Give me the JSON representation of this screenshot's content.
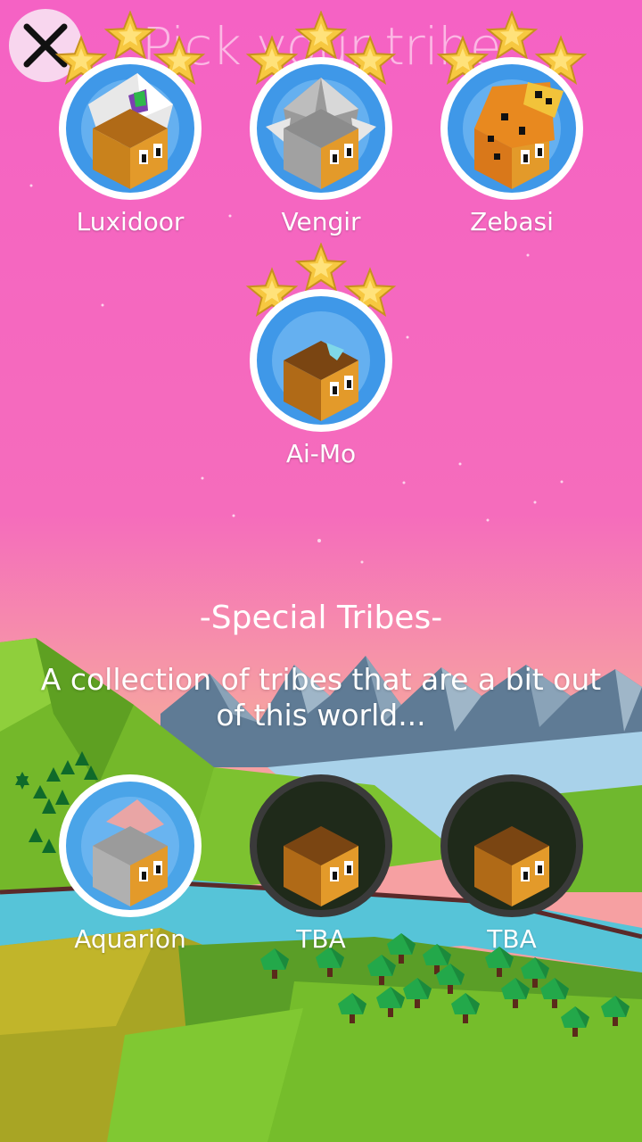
{
  "header": {
    "title": "Pick your tribe"
  },
  "close_button": {
    "icon": "close-icon"
  },
  "tribes": [
    {
      "name": "Luxidoor",
      "stars": 3,
      "unlocked": true
    },
    {
      "name": "Vengir",
      "stars": 3,
      "unlocked": true
    },
    {
      "name": "Zebasi",
      "stars": 3,
      "unlocked": true
    },
    {
      "name": "Ai-Mo",
      "stars": 3,
      "unlocked": true
    }
  ],
  "special": {
    "title": "-Special Tribes-",
    "description": "A collection of tribes that are a bit out of this world...",
    "tribes": [
      {
        "name": "Aquarion",
        "unlocked": true
      },
      {
        "name": "TBA",
        "unlocked": false
      },
      {
        "name": "TBA",
        "unlocked": false
      }
    ]
  },
  "colors": {
    "sky_top": "#f564c3",
    "sky_bottom": "#f7a0a8",
    "badge_blue": "#3f98e8",
    "star_gold": "#f7c840"
  }
}
